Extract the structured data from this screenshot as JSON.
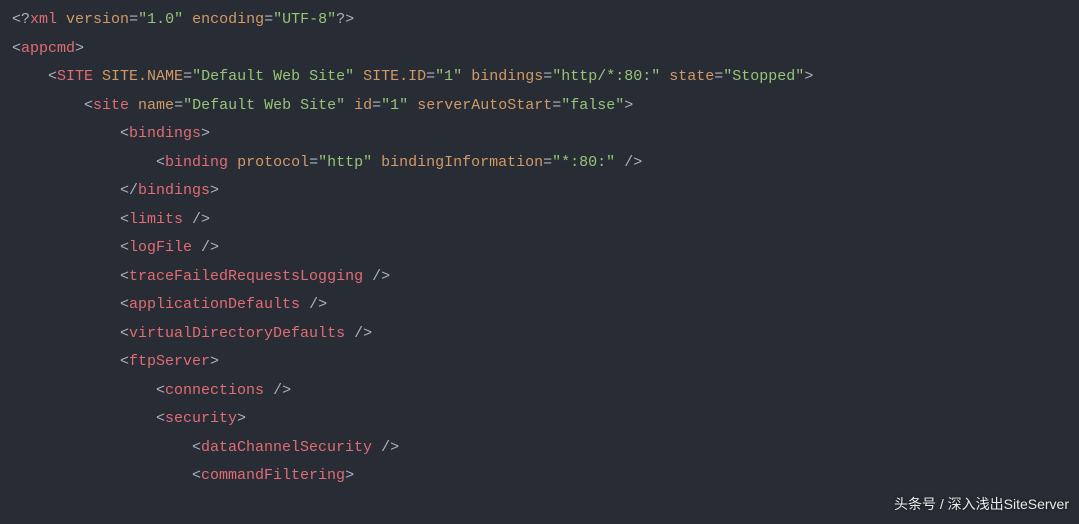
{
  "watermark": "头条号 / 深入浅出SiteServer",
  "tokens": [
    [
      [
        "p",
        "<?"
      ],
      [
        "tg",
        "xml"
      ],
      [
        "p",
        " "
      ],
      [
        "at",
        "version"
      ],
      [
        "p",
        "="
      ],
      [
        "st",
        "\"1.0\""
      ],
      [
        "p",
        " "
      ],
      [
        "at",
        "encoding"
      ],
      [
        "p",
        "="
      ],
      [
        "st",
        "\"UTF-8\""
      ],
      [
        "p",
        "?>"
      ]
    ],
    [
      [
        "p",
        "<"
      ],
      [
        "tg",
        "appcmd"
      ],
      [
        "p",
        ">"
      ]
    ],
    [
      [
        "p",
        "    <"
      ],
      [
        "tg",
        "SITE"
      ],
      [
        "p",
        " "
      ],
      [
        "at",
        "SITE.NAME"
      ],
      [
        "p",
        "="
      ],
      [
        "st",
        "\"Default Web Site\""
      ],
      [
        "p",
        " "
      ],
      [
        "at",
        "SITE.ID"
      ],
      [
        "p",
        "="
      ],
      [
        "st",
        "\"1\""
      ],
      [
        "p",
        " "
      ],
      [
        "at",
        "bindings"
      ],
      [
        "p",
        "="
      ],
      [
        "st",
        "\"http/*:80:\""
      ],
      [
        "p",
        " "
      ],
      [
        "at",
        "state"
      ],
      [
        "p",
        "="
      ],
      [
        "st",
        "\"Stopped\""
      ],
      [
        "p",
        ">"
      ]
    ],
    [
      [
        "p",
        "        <"
      ],
      [
        "tg",
        "site"
      ],
      [
        "p",
        " "
      ],
      [
        "at",
        "name"
      ],
      [
        "p",
        "="
      ],
      [
        "st",
        "\"Default Web Site\""
      ],
      [
        "p",
        " "
      ],
      [
        "at",
        "id"
      ],
      [
        "p",
        "="
      ],
      [
        "st",
        "\"1\""
      ],
      [
        "p",
        " "
      ],
      [
        "at",
        "serverAutoStart"
      ],
      [
        "p",
        "="
      ],
      [
        "st",
        "\"false\""
      ],
      [
        "p",
        ">"
      ]
    ],
    [
      [
        "p",
        "            <"
      ],
      [
        "tg",
        "bindings"
      ],
      [
        "p",
        ">"
      ]
    ],
    [
      [
        "p",
        "                <"
      ],
      [
        "tg",
        "binding"
      ],
      [
        "p",
        " "
      ],
      [
        "at",
        "protocol"
      ],
      [
        "p",
        "="
      ],
      [
        "st",
        "\"http\""
      ],
      [
        "p",
        " "
      ],
      [
        "at",
        "bindingInformation"
      ],
      [
        "p",
        "="
      ],
      [
        "st",
        "\"*:80:\""
      ],
      [
        "p",
        " />"
      ]
    ],
    [
      [
        "p",
        "            </"
      ],
      [
        "tg",
        "bindings"
      ],
      [
        "p",
        ">"
      ]
    ],
    [
      [
        "p",
        "            <"
      ],
      [
        "tg",
        "limits"
      ],
      [
        "p",
        " />"
      ]
    ],
    [
      [
        "p",
        "            <"
      ],
      [
        "tg",
        "logFile"
      ],
      [
        "p",
        " />"
      ]
    ],
    [
      [
        "p",
        "            <"
      ],
      [
        "tg",
        "traceFailedRequestsLogging"
      ],
      [
        "p",
        " />"
      ]
    ],
    [
      [
        "p",
        "            <"
      ],
      [
        "tg",
        "applicationDefaults"
      ],
      [
        "p",
        " />"
      ]
    ],
    [
      [
        "p",
        "            <"
      ],
      [
        "tg",
        "virtualDirectoryDefaults"
      ],
      [
        "p",
        " />"
      ]
    ],
    [
      [
        "p",
        "            <"
      ],
      [
        "tg",
        "ftpServer"
      ],
      [
        "p",
        ">"
      ]
    ],
    [
      [
        "p",
        "                <"
      ],
      [
        "tg",
        "connections"
      ],
      [
        "p",
        " />"
      ]
    ],
    [
      [
        "p",
        "                <"
      ],
      [
        "tg",
        "security"
      ],
      [
        "p",
        ">"
      ]
    ],
    [
      [
        "p",
        "                    <"
      ],
      [
        "tg",
        "dataChannelSecurity"
      ],
      [
        "p",
        " />"
      ]
    ],
    [
      [
        "p",
        "                    <"
      ],
      [
        "tg",
        "commandFiltering"
      ],
      [
        "p",
        ">"
      ]
    ]
  ]
}
